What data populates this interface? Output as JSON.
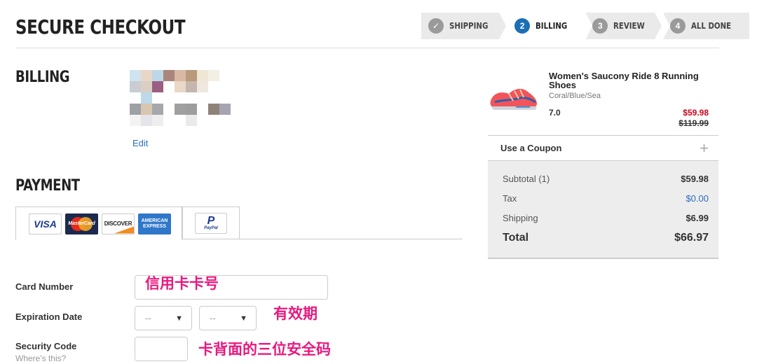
{
  "header": {
    "title": "SECURE CHECKOUT",
    "steps": [
      {
        "badge": "✓",
        "label": "SHIPPING",
        "state": "done"
      },
      {
        "badge": "2",
        "label": "BILLING",
        "state": "active"
      },
      {
        "badge": "3",
        "label": "REVIEW",
        "state": "todo"
      },
      {
        "badge": "4",
        "label": "ALL DONE",
        "state": "todo"
      }
    ]
  },
  "billing": {
    "heading": "BILLING",
    "edit_label": "Edit"
  },
  "payment": {
    "heading": "PAYMENT",
    "card_logos": {
      "visa": "VISA",
      "mastercard": "MasterCard",
      "discover": "DISCOVER",
      "amex_line1": "AMERICAN",
      "amex_line2": "EXPRESS"
    },
    "paypal_logo": {
      "mark": "P",
      "text": "PayPal"
    },
    "card_number_label": "Card Number",
    "expiration_label": "Expiration Date",
    "exp_month_value": "--",
    "exp_year_value": "--",
    "security_code_label": "Security Code",
    "security_help": "Where's this?"
  },
  "annotations": {
    "card_number": "信用卡卡号",
    "expiration": "有效期",
    "security_code": "卡背面的三位安全码"
  },
  "order": {
    "product_name": "Women's Saucony Ride 8 Running Shoes",
    "product_color": "Coral/Blue/Sea",
    "product_size": "7.0",
    "price": "$59.98",
    "original_price": "$119.99",
    "coupon_label": "Use a Coupon",
    "coupon_icon": "+",
    "subtotal_label": "Subtotal (1)",
    "subtotal_value": "$59.98",
    "tax_label": "Tax",
    "tax_value": "$0.00",
    "shipping_label": "Shipping",
    "shipping_value": "$6.99",
    "total_label": "Total",
    "total_value": "$66.97"
  },
  "colors": {
    "accent": "#1a6fb5",
    "sale_price": "#d0021b",
    "annotation": "#e8197f",
    "link": "#2a6ebb"
  }
}
